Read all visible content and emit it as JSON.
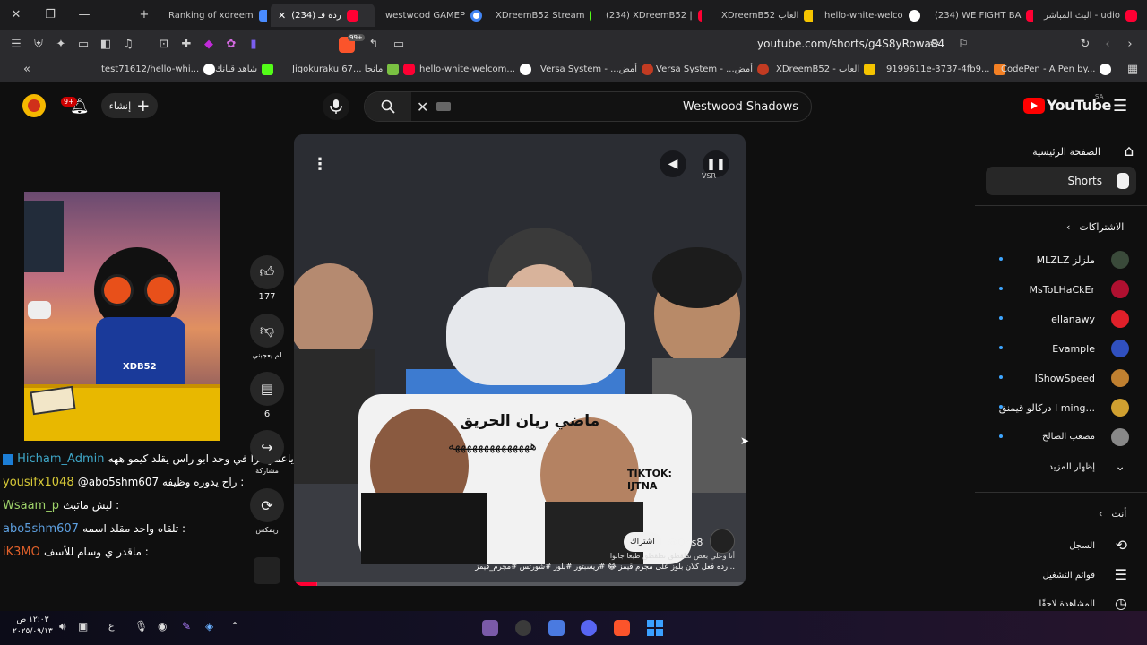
{
  "tabs": [
    {
      "title": "Ranking of xdreem",
      "color": "#4a8cff"
    },
    {
      "title": "(234) ردة فـ",
      "color": "#ff0033"
    },
    {
      "title": "westwood GAMEP",
      "color": "#4285f4"
    },
    {
      "title": "XDreemB52 Stream",
      "color": "#53fc18"
    },
    {
      "title": "(234) XDreemB52 |",
      "color": "#ff0033"
    },
    {
      "title": "XDreemB52 العاب",
      "color": "#f5c400"
    },
    {
      "title": "hello-white-welco",
      "color": "#ffffff"
    },
    {
      "title": "(234) WE FIGHT BA",
      "color": "#ff0033"
    },
    {
      "title": "البث المباشر - udio",
      "color": "#ff0033"
    }
  ],
  "address": {
    "url": "youtube.com/shorts/g4S8yRowa84",
    "brave_count": "99+"
  },
  "bookmarks": [
    {
      "label": "test71612/hello-whi...",
      "color": "#ffffff"
    },
    {
      "label": "شاهد قنانك",
      "color": "#53fc18"
    },
    {
      "label": "Jigokuraku 67... مانجا",
      "color": "#7ac142"
    },
    {
      "label": "hello-white-welcom...",
      "color": "#ffffff"
    },
    {
      "label": "Versa System - ...أمض",
      "color": "#c23b22"
    },
    {
      "label": "Versa System - ...أمض",
      "color": "#c23b22"
    },
    {
      "label": "XDreemB52 - العاب",
      "color": "#f5c400"
    },
    {
      "label": "9199611e-3737-4fb9...",
      "color": "#f48024"
    },
    {
      "label": "CodePen - A Pen by...",
      "color": "#ffffff"
    }
  ],
  "yt": {
    "logo_text": "YouTube",
    "region": "SA",
    "search_query": "Westwood Shadows",
    "create_label": "إنشاء",
    "notif_count": "9+"
  },
  "sidebar": {
    "home": "الصفحة الرئيسية",
    "shorts": "Shorts",
    "subs_header": "الاشتراكات",
    "subs": [
      {
        "name": "MLZLZ ملزلز",
        "color": "#3a4a3a"
      },
      {
        "name": "MsToLHaCkEr",
        "color": "#b01030"
      },
      {
        "name": "ellanawy",
        "color": "#e0202a"
      },
      {
        "name": "Evample",
        "color": "#3050c0"
      },
      {
        "name": "IShowSpeed",
        "color": "#c08030"
      },
      {
        "name": "دركالو قيمنق I ming...",
        "color": "#d0a030"
      },
      {
        "name": "مصعب الصالح",
        "color": "#888888"
      }
    ],
    "show_more": "إظهار المزيد",
    "you_header": "أنت",
    "you_items": [
      "السجل",
      "قوائم التشغيل",
      "المشاهدة لاحقًا"
    ]
  },
  "actions": {
    "likes": "177",
    "dislike_label": "لم يعجبني",
    "comments": "6",
    "share_label": "مشاركة",
    "remix_label": "ريمكس"
  },
  "video": {
    "overlay_title": "ماضي ريان الحريق",
    "overlay_laugh": "ههههههههههههههه",
    "tiktok_tag": "TIKTOK: IJTNA",
    "channel": "@Qr.s8",
    "subscribe": "اشتراك",
    "desc_line1": "أنا وعلي بعض تطقطق تطقطق طبعا جابوا",
    "desc_line2": "رده فعل كلان بلوز على مجرم قيمز 😂 #ريسبتور #بلوز #شورتس #مجرم_قيمز ..",
    "vsr": "VSR",
    "progress": 0.05
  },
  "stream": {
    "avatar_name": "XDB52",
    "chat": [
      {
        "user": "Hicham_Admin",
        "color": "#3fa7c8",
        "msg": "ياعمي ترا في وحد ابو راس يقلد كيمو ههه :"
      },
      {
        "user": "yousifx1048",
        "color": "#d7c937",
        "msg": "@abo5shm607 راح يدوره وظيفه :"
      },
      {
        "user": "Wsaam_p",
        "color": "#9fd36a",
        "msg": "ليش ماتبث :"
      },
      {
        "user": "abo5shm607",
        "color": "#5ea0e0",
        "msg": "تلقاه واحد مقلد اسمه :"
      },
      {
        "user": "iK3MO",
        "color": "#e0602a",
        "msg": "ماقدر ي وسام للأسف :"
      }
    ]
  },
  "taskbar": {
    "time": "١٢:٠٣ ص",
    "date": "٢٠٢٥/٠٩/١٣",
    "lang": "ع"
  }
}
